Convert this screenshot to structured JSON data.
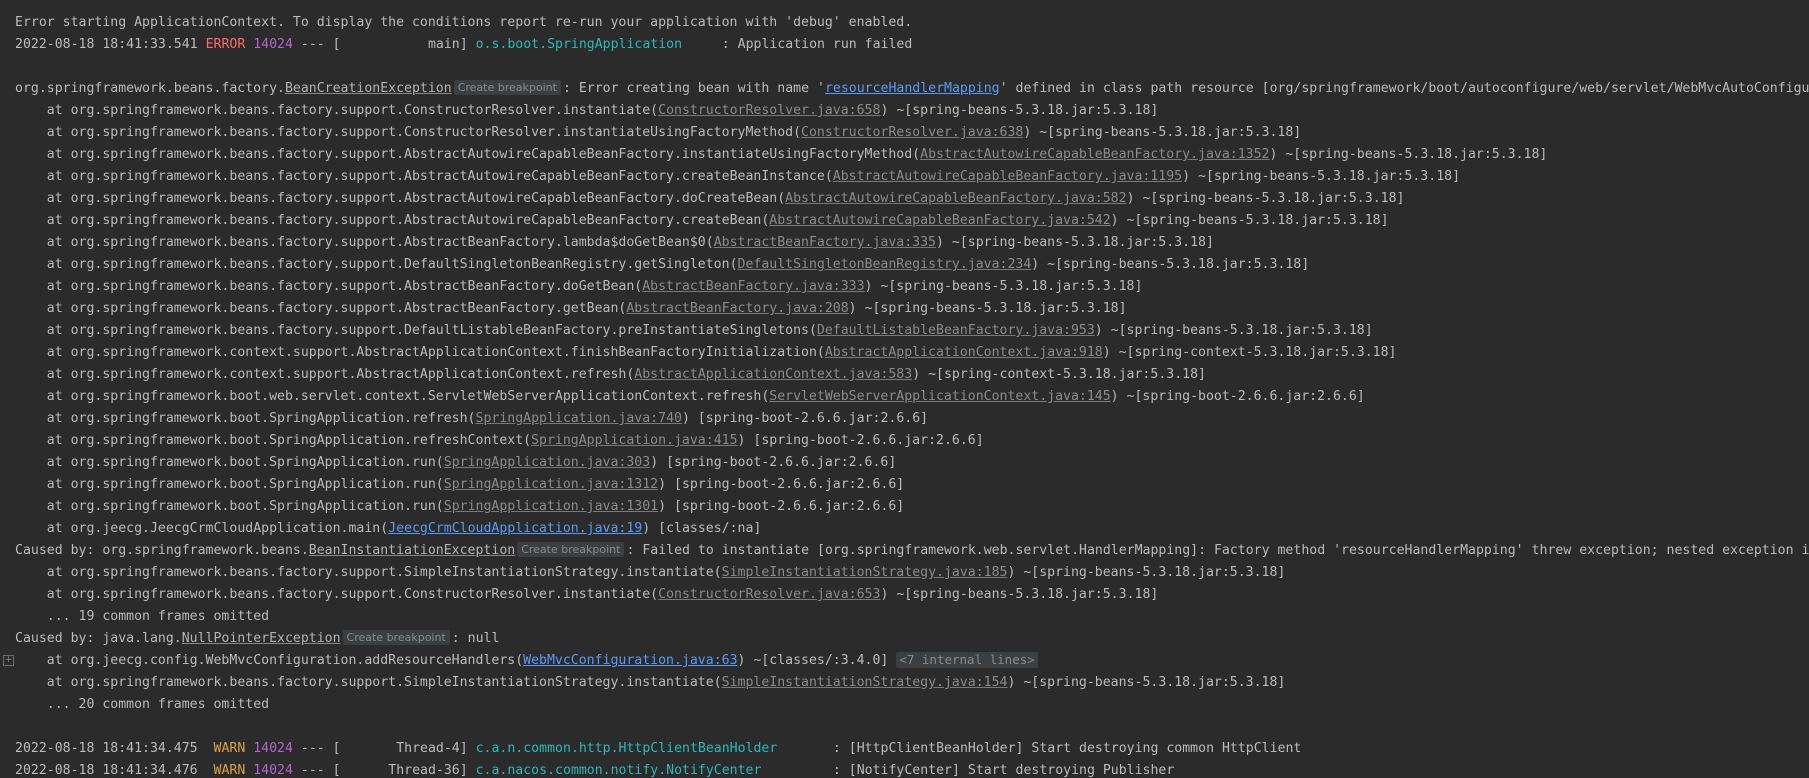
{
  "console": {
    "lines": [
      {
        "kind": "plain",
        "text": "Error starting ApplicationContext. To display the conditions report re-run your application with 'debug' enabled."
      },
      {
        "kind": "log",
        "timestamp": "2022-08-18 18:41:33.541",
        "level": "ERROR",
        "pid": "14024",
        "sep": "---",
        "thread": "[           main]",
        "logger": "o.s.boot.SpringApplication",
        "message": ": Application run failed"
      },
      {
        "kind": "blank"
      },
      {
        "kind": "exception",
        "prefix": "org.springframework.beans.factory.",
        "exception": "BeanCreationException",
        "breakpoint": "Create breakpoint",
        "message_start": ": Error creating bean with name '",
        "bean": "resourceHandlerMapping",
        "message_end": "' defined in class path resource [org/springframework/boot/autoconfigure/web/servlet/WebMvcAutoConfiguration$EnableWebMvcConfiguration.class]"
      },
      {
        "kind": "frame",
        "method": "at org.springframework.beans.factory.support.ConstructorResolver.instantiate(",
        "source": "ConstructorResolver.java:658",
        "suffix": ") ~[spring-beans-5.3.18.jar:5.3.18]"
      },
      {
        "kind": "frame",
        "method": "at org.springframework.beans.factory.support.ConstructorResolver.instantiateUsingFactoryMethod(",
        "source": "ConstructorResolver.java:638",
        "suffix": ") ~[spring-beans-5.3.18.jar:5.3.18]"
      },
      {
        "kind": "frame",
        "method": "at org.springframework.beans.factory.support.AbstractAutowireCapableBeanFactory.instantiateUsingFactoryMethod(",
        "source": "AbstractAutowireCapableBeanFactory.java:1352",
        "suffix": ") ~[spring-beans-5.3.18.jar:5.3.18]"
      },
      {
        "kind": "frame",
        "method": "at org.springframework.beans.factory.support.AbstractAutowireCapableBeanFactory.createBeanInstance(",
        "source": "AbstractAutowireCapableBeanFactory.java:1195",
        "suffix": ") ~[spring-beans-5.3.18.jar:5.3.18]"
      },
      {
        "kind": "frame",
        "method": "at org.springframework.beans.factory.support.AbstractAutowireCapableBeanFactory.doCreateBean(",
        "source": "AbstractAutowireCapableBeanFactory.java:582",
        "suffix": ") ~[spring-beans-5.3.18.jar:5.3.18]"
      },
      {
        "kind": "frame",
        "method": "at org.springframework.beans.factory.support.AbstractAutowireCapableBeanFactory.createBean(",
        "source": "AbstractAutowireCapableBeanFactory.java:542",
        "suffix": ") ~[spring-beans-5.3.18.jar:5.3.18]"
      },
      {
        "kind": "frame",
        "method": "at org.springframework.beans.factory.support.AbstractBeanFactory.lambda$doGetBean$0(",
        "source": "AbstractBeanFactory.java:335",
        "suffix": ") ~[spring-beans-5.3.18.jar:5.3.18]"
      },
      {
        "kind": "frame",
        "method": "at org.springframework.beans.factory.support.DefaultSingletonBeanRegistry.getSingleton(",
        "source": "DefaultSingletonBeanRegistry.java:234",
        "suffix": ") ~[spring-beans-5.3.18.jar:5.3.18]"
      },
      {
        "kind": "frame",
        "method": "at org.springframework.beans.factory.support.AbstractBeanFactory.doGetBean(",
        "source": "AbstractBeanFactory.java:333",
        "suffix": ") ~[spring-beans-5.3.18.jar:5.3.18]"
      },
      {
        "kind": "frame",
        "method": "at org.springframework.beans.factory.support.AbstractBeanFactory.getBean(",
        "source": "AbstractBeanFactory.java:208",
        "suffix": ") ~[spring-beans-5.3.18.jar:5.3.18]"
      },
      {
        "kind": "frame",
        "method": "at org.springframework.beans.factory.support.DefaultListableBeanFactory.preInstantiateSingletons(",
        "source": "DefaultListableBeanFactory.java:953",
        "suffix": ") ~[spring-beans-5.3.18.jar:5.3.18]"
      },
      {
        "kind": "frame",
        "method": "at org.springframework.context.support.AbstractApplicationContext.finishBeanFactoryInitialization(",
        "source": "AbstractApplicationContext.java:918",
        "suffix": ") ~[spring-context-5.3.18.jar:5.3.18]"
      },
      {
        "kind": "frame",
        "method": "at org.springframework.context.support.AbstractApplicationContext.refresh(",
        "source": "AbstractApplicationContext.java:583",
        "suffix": ") ~[spring-context-5.3.18.jar:5.3.18]"
      },
      {
        "kind": "frame",
        "method": "at org.springframework.boot.web.servlet.context.ServletWebServerApplicationContext.refresh(",
        "source": "ServletWebServerApplicationContext.java:145",
        "suffix": ") ~[spring-boot-2.6.6.jar:2.6.6]"
      },
      {
        "kind": "frame",
        "method": "at org.springframework.boot.SpringApplication.refresh(",
        "source": "SpringApplication.java:740",
        "suffix": ") [spring-boot-2.6.6.jar:2.6.6]"
      },
      {
        "kind": "frame",
        "method": "at org.springframework.boot.SpringApplication.refreshContext(",
        "source": "SpringApplication.java:415",
        "suffix": ") [spring-boot-2.6.6.jar:2.6.6]"
      },
      {
        "kind": "frame",
        "method": "at org.springframework.boot.SpringApplication.run(",
        "source": "SpringApplication.java:303",
        "suffix": ") [spring-boot-2.6.6.jar:2.6.6]"
      },
      {
        "kind": "frame",
        "method": "at org.springframework.boot.SpringApplication.run(",
        "source": "SpringApplication.java:1312",
        "suffix": ") [spring-boot-2.6.6.jar:2.6.6]"
      },
      {
        "kind": "frame",
        "method": "at org.springframework.boot.SpringApplication.run(",
        "source": "SpringApplication.java:1301",
        "suffix": ") [spring-boot-2.6.6.jar:2.6.6]"
      },
      {
        "kind": "frame",
        "method": "at org.jeecg.JeecgCrmCloudApplication.main(",
        "source": "JeecgCrmCloudApplication.java:19",
        "suffix": ") [classes/:na]",
        "active": true
      },
      {
        "kind": "caused",
        "prefix": "Caused by: org.springframework.beans.",
        "exception": "BeanInstantiationException",
        "breakpoint": "Create breakpoint",
        "message": ": Failed to instantiate [org.springframework.web.servlet.HandlerMapping]: Factory method 'resourceHandlerMapping' threw exception; nested exception is java.lang.NullPointerException"
      },
      {
        "kind": "frame",
        "method": "at org.springframework.beans.factory.support.SimpleInstantiationStrategy.instantiate(",
        "source": "SimpleInstantiationStrategy.java:185",
        "suffix": ") ~[spring-beans-5.3.18.jar:5.3.18]"
      },
      {
        "kind": "frame",
        "method": "at org.springframework.beans.factory.support.ConstructorResolver.instantiate(",
        "source": "ConstructorResolver.java:653",
        "suffix": ") ~[spring-beans-5.3.18.jar:5.3.18]"
      },
      {
        "kind": "omitted",
        "text": "... 19 common frames omitted"
      },
      {
        "kind": "caused",
        "prefix": "Caused by: java.lang.",
        "exception": "NullPointerException",
        "breakpoint": "Create breakpoint",
        "message": ": null"
      },
      {
        "kind": "frame",
        "method": "at org.jeecg.config.WebMvcConfiguration.addResourceHandlers(",
        "source": "WebMvcConfiguration.java:63",
        "suffix": ") ~[classes/:3.4.0] ",
        "active": true,
        "fold": "+",
        "internal": "<7 internal lines>"
      },
      {
        "kind": "frame",
        "method": "at org.springframework.beans.factory.support.SimpleInstantiationStrategy.instantiate(",
        "source": "SimpleInstantiationStrategy.java:154",
        "suffix": ") ~[spring-beans-5.3.18.jar:5.3.18]"
      },
      {
        "kind": "omitted",
        "text": "... 20 common frames omitted"
      },
      {
        "kind": "blank"
      },
      {
        "kind": "log",
        "timestamp": "2022-08-18 18:41:34.475",
        "level": " WARN",
        "pid": "14024",
        "sep": "---",
        "thread": "[       Thread-4]",
        "logger": "c.a.n.common.http.HttpClientBeanHolder  ",
        "message": ": [HttpClientBeanHolder] Start destroying common HttpClient"
      },
      {
        "kind": "log",
        "timestamp": "2022-08-18 18:41:34.476",
        "level": " WARN",
        "pid": "14024",
        "sep": "---",
        "thread": "[      Thread-36]",
        "logger": "c.a.nacos.common.notify.NotifyCenter    ",
        "message": ": [NotifyCenter] Start destroying Publisher"
      }
    ]
  }
}
